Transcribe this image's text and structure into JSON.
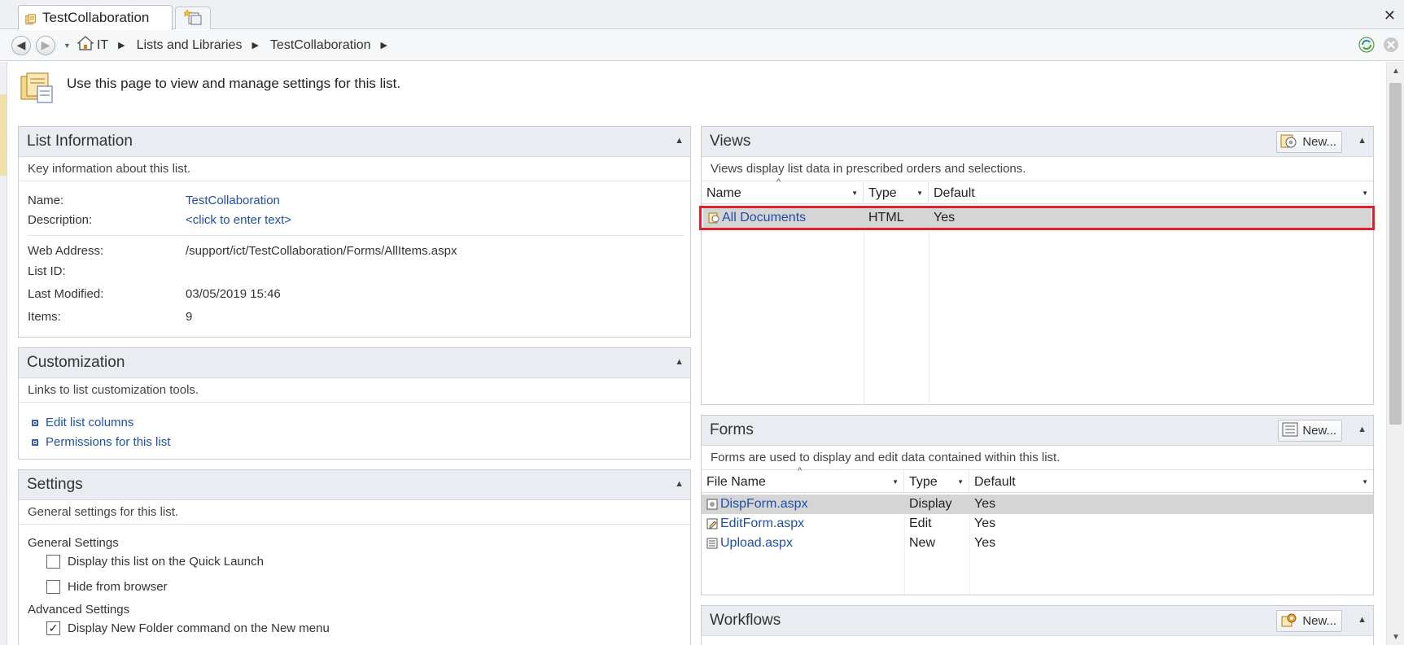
{
  "tabs": {
    "active_label": "TestCollaboration",
    "new_tab_icon": "new-tab-icon"
  },
  "breadcrumb": {
    "items": [
      "IT",
      "Lists and Libraries",
      "TestCollaboration"
    ]
  },
  "intro": {
    "text": "Use this page to view and manage settings for this list."
  },
  "list_information": {
    "title": "List Information",
    "description": "Key information about this list.",
    "name_label": "Name:",
    "name_value": "TestCollaboration",
    "description_label": "Description:",
    "description_value": "<click to enter text>",
    "web_address_label": "Web Address:",
    "web_address_value": "/support/ict/TestCollaboration/Forms/AllItems.aspx",
    "list_id_label": "List ID:",
    "last_modified_label": "Last Modified:",
    "last_modified_value": "03/05/2019 15:46",
    "items_label": "Items:",
    "items_value": "9"
  },
  "customization": {
    "title": "Customization",
    "description": "Links to list customization tools.",
    "links": [
      "Edit list columns",
      "Permissions for this list"
    ]
  },
  "settings": {
    "title": "Settings",
    "description": "General settings for this list.",
    "general_heading": "General Settings",
    "general_options": [
      {
        "label": "Display this list on the Quick Launch",
        "checked": false
      },
      {
        "label": "Hide from browser",
        "checked": false
      }
    ],
    "advanced_heading": "Advanced Settings",
    "advanced_options": [
      {
        "label": "Display New Folder command on the New menu",
        "checked": true
      }
    ]
  },
  "views": {
    "title": "Views",
    "new_label": "New...",
    "description": "Views display list data in prescribed orders and selections.",
    "columns": [
      "Name",
      "Type",
      "Default"
    ],
    "rows": [
      {
        "name": "All Documents",
        "type": "HTML",
        "default": "Yes",
        "selected": true
      }
    ]
  },
  "forms": {
    "title": "Forms",
    "new_label": "New...",
    "description": "Forms are used to display and edit data contained within this list.",
    "columns": [
      "File Name",
      "Type",
      "Default"
    ],
    "rows": [
      {
        "name": "DispForm.aspx",
        "type": "Display",
        "default": "Yes",
        "selected": true
      },
      {
        "name": "EditForm.aspx",
        "type": "Edit",
        "default": "Yes",
        "selected": false
      },
      {
        "name": "Upload.aspx",
        "type": "New",
        "default": "Yes",
        "selected": false
      }
    ]
  },
  "workflows": {
    "title": "Workflows",
    "new_label": "New..."
  },
  "colors": {
    "highlight": "#e0202c",
    "link": "#1f4fa6",
    "panel_header": "#e9ecf0",
    "selected_row": "#d5d5d5"
  }
}
